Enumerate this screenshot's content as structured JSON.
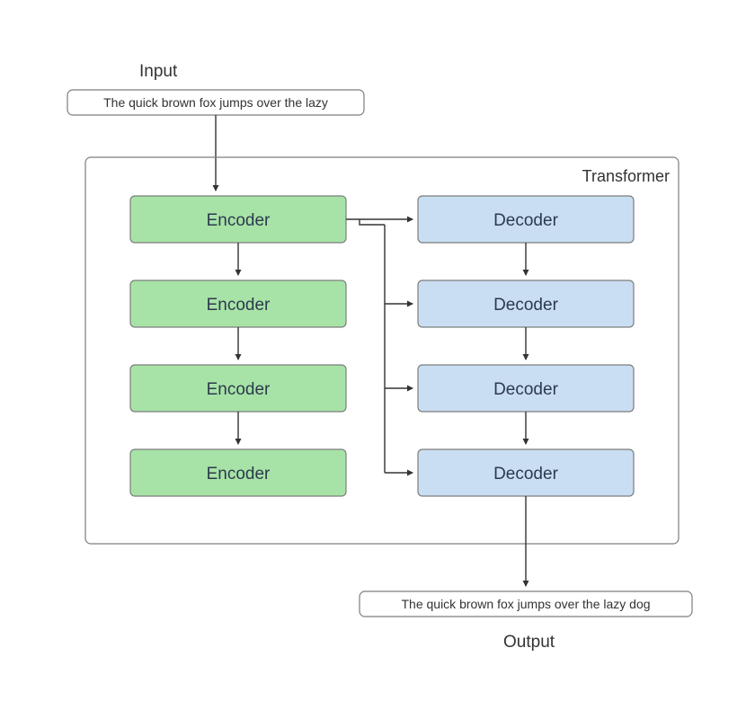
{
  "labels": {
    "input": "Input",
    "output": "Output",
    "transformer": "Transformer"
  },
  "io": {
    "input_text": "The quick brown fox jumps over the lazy",
    "output_text": "The quick brown fox jumps over the lazy dog"
  },
  "encoders": [
    "Encoder",
    "Encoder",
    "Encoder",
    "Encoder"
  ],
  "decoders": [
    "Decoder",
    "Decoder",
    "Decoder",
    "Decoder"
  ],
  "colors": {
    "encoder_fill": "#a7e3a7",
    "decoder_fill": "#c9def2",
    "stroke": "#7d7d7d",
    "text_dark": "#2d3a4d"
  }
}
